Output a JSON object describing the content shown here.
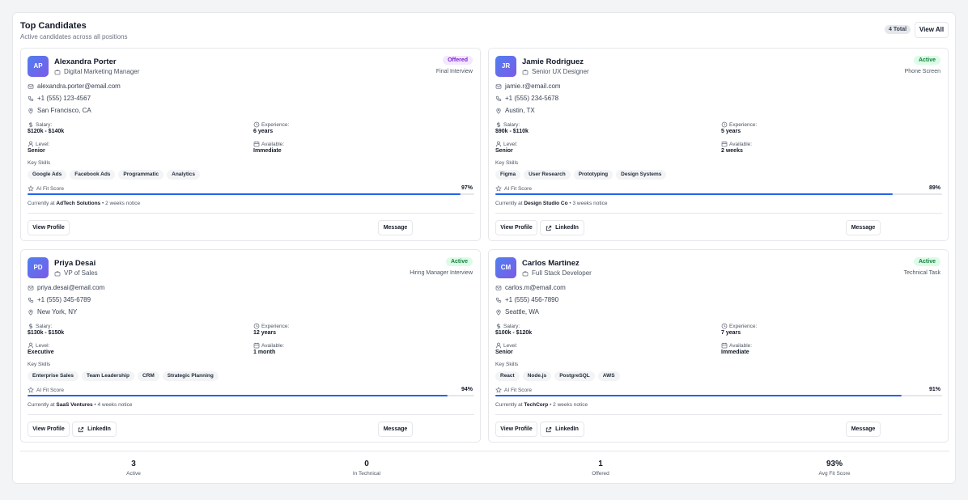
{
  "header": {
    "title": "Top Candidates",
    "subtitle": "Active candidates across all positions",
    "total_badge": "4 Total",
    "view_all": "View All"
  },
  "labels": {
    "salary": "Salary:",
    "experience": "Experience:",
    "level": "Level:",
    "available": "Available:",
    "key_skills": "Key Skills",
    "ai_fit": "AI Fit Score",
    "view_profile": "View Profile",
    "linkedin": "LinkedIn",
    "message": "Message"
  },
  "candidates": [
    {
      "initials": "AP",
      "name": "Alexandra Porter",
      "role": "Digital Marketing Manager",
      "status": "Offered",
      "stage": "Final Interview",
      "email": "alexandra.porter@email.com",
      "phone": "+1 (555) 123-4567",
      "location": "San Francisco, CA",
      "salary": "$120k - $140k",
      "experience": "6 years",
      "level": "Senior",
      "available": "Immediate",
      "skills": [
        "Google Ads",
        "Facebook Ads",
        "Programmatic",
        "Analytics"
      ],
      "fit": "97%",
      "fit_value": 0.97,
      "company": "AdTech Solutions",
      "notice": " • 2 weeks notice",
      "current_prefix": "Currently at ",
      "has_linkedin": false
    },
    {
      "initials": "JR",
      "name": "Jamie Rodriguez",
      "role": "Senior UX Designer",
      "status": "Active",
      "stage": "Phone Screen",
      "email": "jamie.r@email.com",
      "phone": "+1 (555) 234-5678",
      "location": "Austin, TX",
      "salary": "$90k - $110k",
      "experience": "5 years",
      "level": "Senior",
      "available": "2 weeks",
      "skills": [
        "Figma",
        "User Research",
        "Prototyping",
        "Design Systems"
      ],
      "fit": "89%",
      "fit_value": 0.89,
      "company": "Design Studio Co",
      "notice": " • 3 weeks notice",
      "current_prefix": "Currently at ",
      "has_linkedin": true
    },
    {
      "initials": "PD",
      "name": "Priya Desai",
      "role": "VP of Sales",
      "status": "Active",
      "stage": "Hiring Manager Interview",
      "email": "priya.desai@email.com",
      "phone": "+1 (555) 345-6789",
      "location": "New York, NY",
      "salary": "$130k - $150k",
      "experience": "12 years",
      "level": "Executive",
      "available": "1 month",
      "skills": [
        "Enterprise Sales",
        "Team Leadership",
        "CRM",
        "Strategic Planning"
      ],
      "fit": "94%",
      "fit_value": 0.94,
      "company": "SaaS Ventures",
      "notice": " • 4 weeks notice",
      "current_prefix": "Currently at ",
      "has_linkedin": true
    },
    {
      "initials": "CM",
      "name": "Carlos Martinez",
      "role": "Full Stack Developer",
      "status": "Active",
      "stage": "Technical Task",
      "email": "carlos.m@email.com",
      "phone": "+1 (555) 456-7890",
      "location": "Seattle, WA",
      "salary": "$100k - $120k",
      "experience": "7 years",
      "level": "Senior",
      "available": "Immediate",
      "skills": [
        "React",
        "Node.js",
        "PostgreSQL",
        "AWS"
      ],
      "fit": "91%",
      "fit_value": 0.91,
      "company": "TechCorp",
      "notice": " • 2 weeks notice",
      "current_prefix": "Currently at ",
      "has_linkedin": true
    }
  ],
  "stats": [
    {
      "value": "3",
      "label": "Active"
    },
    {
      "value": "0",
      "label": "In Technical"
    },
    {
      "value": "1",
      "label": "Offered"
    },
    {
      "value": "93%",
      "label": "Avg Fit Score"
    }
  ],
  "colors": {
    "accent": "#2563eb",
    "offered_bg": "#f3e8ff",
    "offered_fg": "#7e22ce",
    "active_bg": "#dcfce7",
    "active_fg": "#15803d"
  }
}
